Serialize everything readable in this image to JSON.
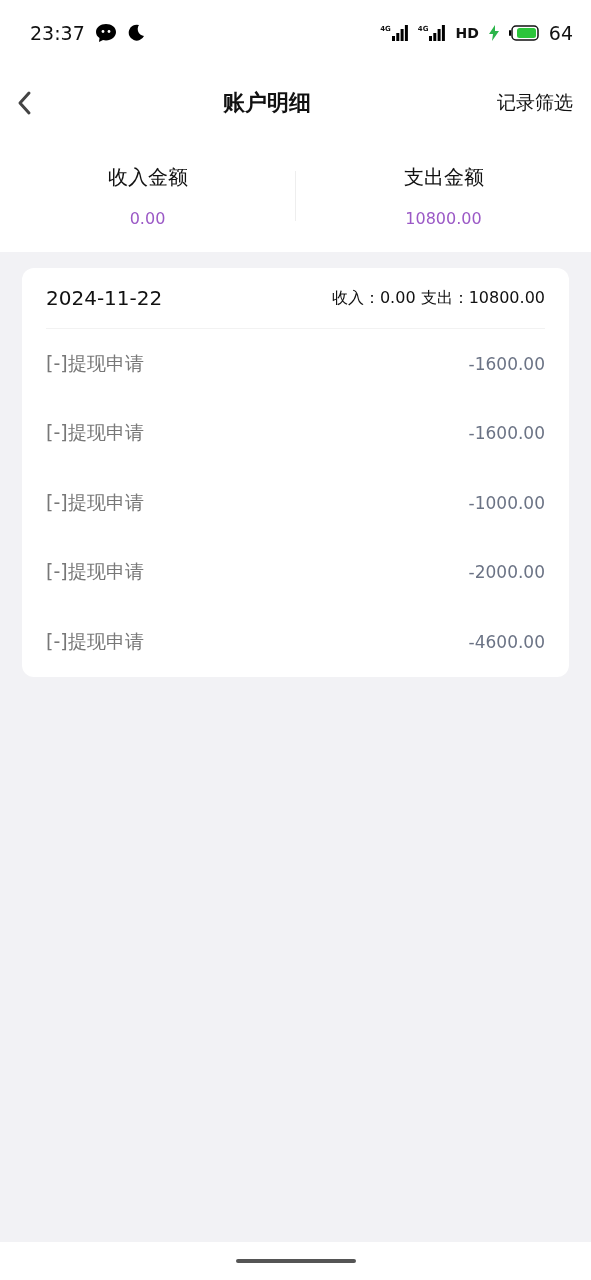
{
  "status_bar": {
    "time": "23:37",
    "signals": [
      "4G",
      "4G"
    ],
    "hd": "HD",
    "battery_level": "64"
  },
  "header": {
    "title": "账户明细",
    "action": "记录筛选"
  },
  "summary": [
    {
      "label": "收入金额",
      "amount": "0.00"
    },
    {
      "label": "支出金额",
      "amount": "10800.00"
    }
  ],
  "groups": [
    {
      "date": "2024-11-22",
      "totals": "收入：0.00 支出：10800.00",
      "records": [
        {
          "title": "[-]提现申请",
          "amount": "-1600.00"
        },
        {
          "title": "[-]提现申请",
          "amount": "-1600.00"
        },
        {
          "title": "[-]提现申请",
          "amount": "-1000.00"
        },
        {
          "title": "[-]提现申请",
          "amount": "-2000.00"
        },
        {
          "title": "[-]提现申请",
          "amount": "-4600.00"
        }
      ]
    }
  ]
}
